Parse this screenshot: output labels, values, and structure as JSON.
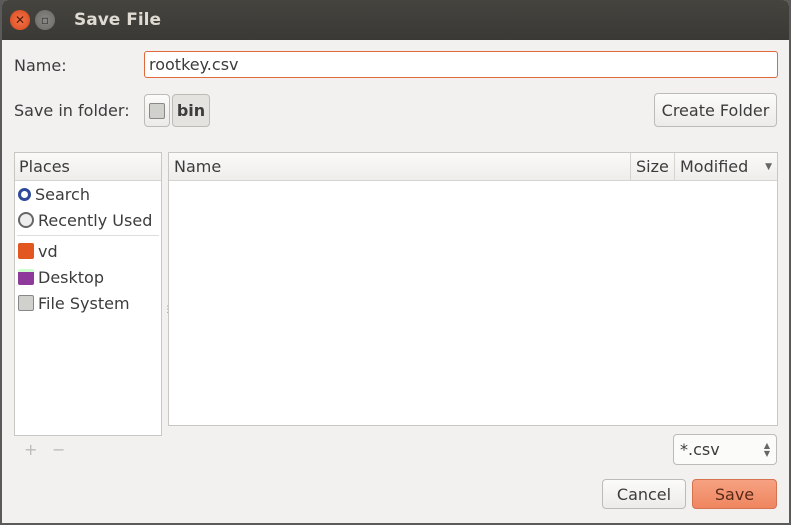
{
  "window": {
    "title": "Save File"
  },
  "name_label": "Name:",
  "name_value": "rootkey.csv",
  "folder_label": "Save in folder:",
  "folder_path": [
    "bin"
  ],
  "create_folder": "Create Folder",
  "places": {
    "header": "Places",
    "items": [
      {
        "label": "Search",
        "icon": "search-icon"
      },
      {
        "label": "Recently Used",
        "icon": "clock-icon"
      },
      {
        "label": "vd",
        "icon": "home-folder-icon"
      },
      {
        "label": "Desktop",
        "icon": "desktop-icon"
      },
      {
        "label": "File System",
        "icon": "drive-icon"
      }
    ]
  },
  "columns": {
    "name": "Name",
    "size": "Size",
    "modified": "Modified"
  },
  "add": "+",
  "remove": "−",
  "filter": "*.csv",
  "cancel": "Cancel",
  "save": "Save",
  "colors": {
    "accent": "#f0845e",
    "titlebar": "#3c3b37"
  }
}
